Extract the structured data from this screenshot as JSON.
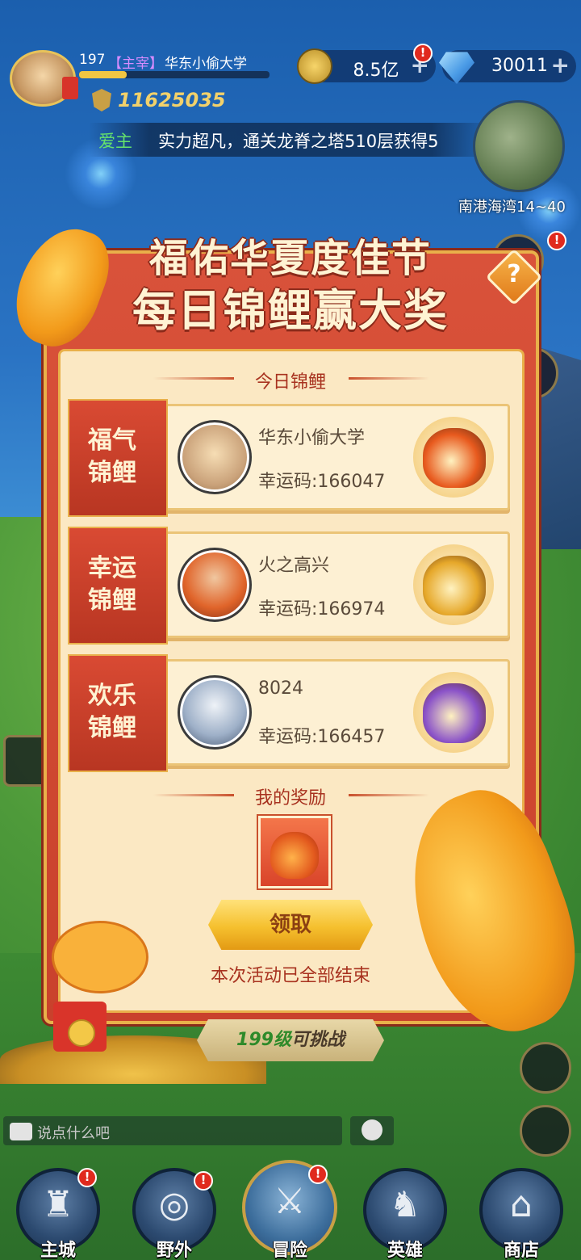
{
  "hud": {
    "player_level": "197",
    "player_rank": "【主宰】",
    "player_name": "华东小偷大学",
    "xp_progress": 0.25,
    "power": "11625035",
    "coins": "8.5亿",
    "gems": "30011",
    "alert": "!"
  },
  "marquee": {
    "name": "爱主",
    "text": "实力超凡，通关龙脊之塔510层获得5"
  },
  "minimap": {
    "location": "南港海湾14~40"
  },
  "event": {
    "title_line1": "福佑华夏度佳节",
    "title_line2": "每日锦鲤赢大奖",
    "help_label": "?",
    "today_header": "今日锦鲤",
    "winners": [
      {
        "tag": "福气锦鲤",
        "name": "华东小偷大学",
        "code": "幸运码:166047",
        "bag_color": "#e85a1e"
      },
      {
        "tag": "幸运锦鲤",
        "name": "火之高兴",
        "code": "幸运码:166974",
        "bag_color": "#e6a82a"
      },
      {
        "tag": "欢乐锦鲤",
        "name": "8024",
        "code": "幸运码:166457",
        "bag_color": "#8a52c8"
      }
    ],
    "my_reward_header": "我的奖励",
    "claim_label": "领取",
    "ended_text": "本次活动已全部结束"
  },
  "bottom": {
    "challenge_level": "199级",
    "challenge_text": "可挑战",
    "chat_placeholder": "说点什么吧",
    "nav": [
      {
        "label": "主城",
        "icon": "castle-icon"
      },
      {
        "label": "野外",
        "icon": "portal-icon"
      },
      {
        "label": "冒险",
        "icon": "sword-icon"
      },
      {
        "label": "英雄",
        "icon": "helmet-icon"
      },
      {
        "label": "商店",
        "icon": "shop-icon"
      }
    ]
  },
  "colors": {
    "modal_red": "#d9523a",
    "panel_cream": "#fbe8c3",
    "gold": "#e9b04a",
    "accent_text": "#a8321f",
    "green_name": "#66e36b"
  }
}
